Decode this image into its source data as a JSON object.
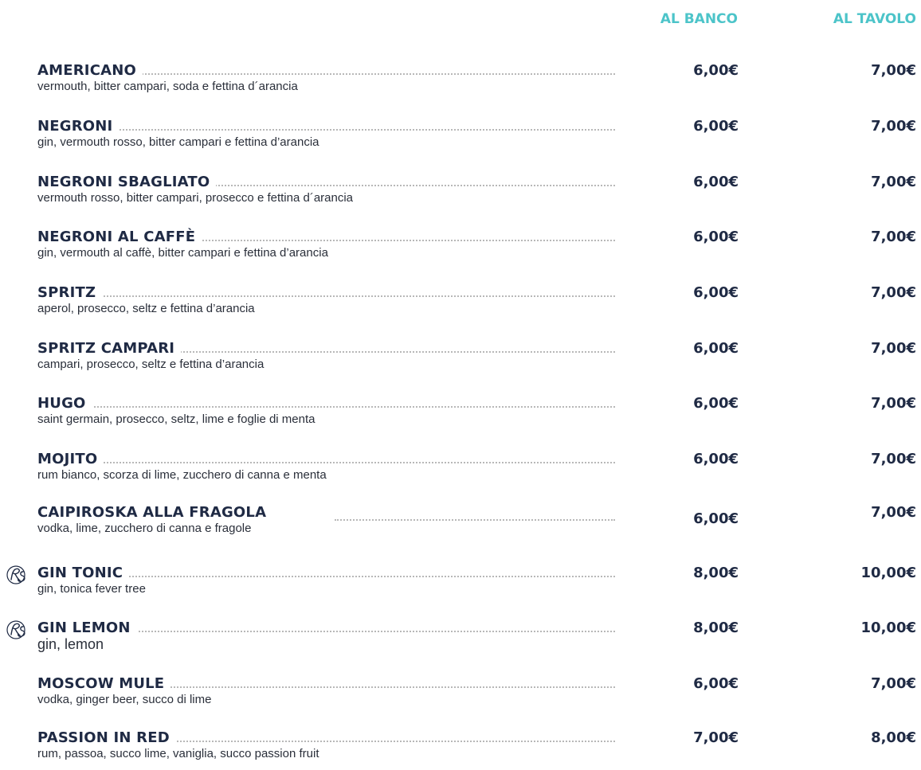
{
  "headers": {
    "banco": "AL BANCO",
    "tavolo": "AL TAVOLO"
  },
  "items": [
    {
      "name": "AMERICANO",
      "desc": "vermouth, bitter campari, soda e fettina d´arancia",
      "banco": "6,00€",
      "tavolo": "7,00€"
    },
    {
      "name": "NEGRONI",
      "desc": "gin, vermouth rosso, bitter campari e fettina d’arancia",
      "banco": "6,00€",
      "tavolo": "7,00€"
    },
    {
      "name": "NEGRONI SBAGLIATO",
      "desc": "vermouth rosso, bitter campari, prosecco e fettina d´arancia",
      "banco": "6,00€",
      "tavolo": "7,00€"
    },
    {
      "name": "NEGRONI AL CAFFÈ",
      "desc": "gin, vermouth al caffè, bitter campari e fettina d’arancia",
      "banco": "6,00€",
      "tavolo": "7,00€"
    },
    {
      "name": "SPRITZ",
      "desc": "aperol, prosecco, seltz e fettina d’arancia",
      "banco": "6,00€",
      "tavolo": "7,00€"
    },
    {
      "name": "SPRITZ CAMPARI",
      "desc": "campari, prosecco, seltz e fettina d’arancia",
      "banco": "6,00€",
      "tavolo": "7,00€"
    },
    {
      "name": "HUGO",
      "desc": "saint germain, prosecco, seltz, lime e foglie di menta",
      "banco": "6,00€",
      "tavolo": "7,00€"
    },
    {
      "name": "MOJITO",
      "desc": "rum bianco, scorza di lime, zucchero di canna e menta",
      "banco": "6,00€",
      "tavolo": "7,00€"
    },
    {
      "name": "CAIPIROSKA ALLA FRAGOLA",
      "desc": "vodka, lime, zucchero di canna e fragole",
      "banco": "6,00€",
      "tavolo": "7,00€"
    },
    {
      "name": "GIN TONIC",
      "desc": "gin, tonica fever tree",
      "banco": "8,00€",
      "tavolo": "10,00€"
    },
    {
      "name": "GIN LEMON",
      "desc": "gin, lemon",
      "banco": "8,00€",
      "tavolo": "10,00€"
    },
    {
      "name": "MOSCOW MULE",
      "desc": "vodka, ginger beer, succo di lime",
      "banco": "6,00€",
      "tavolo": "7,00€"
    },
    {
      "name": "PASSION IN RED",
      "desc": "rum, passoa, succo lime, vaniglia, succo passion fruit",
      "banco": "7,00€",
      "tavolo": "8,00€"
    }
  ],
  "colors": {
    "accent": "#4cc4c9",
    "text": "#1f2a44",
    "dots": "#b8b8b8"
  },
  "icons": {
    "logo": "rs-monogram-icon"
  }
}
